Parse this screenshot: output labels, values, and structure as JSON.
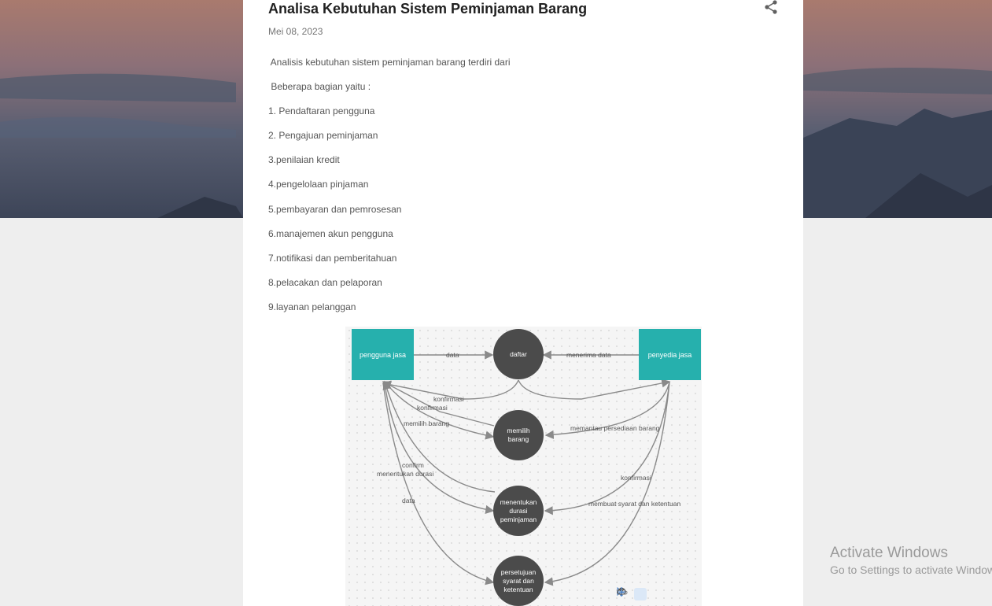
{
  "post": {
    "title": "Analisa Kebutuhan Sistem Peminjaman Barang",
    "date": "Mei 08, 2023",
    "share_icon": "share-icon",
    "lines": [
      " Analisis kebutuhan sistem peminjaman barang terdiri dari",
      " Beberapa bagian yaitu :",
      "1. Pendaftaran pengguna",
      "2. Pengajuan peminjaman",
      "3.penilaian kredit",
      "4.pengelolaan pinjaman",
      "5.pembayaran dan pemrosesan",
      "6.manajemen akun pengguna",
      "7.notifikasi dan pemberitahuan",
      "8.pelacakan dan pelaporan",
      "9.layanan pelanggan"
    ]
  },
  "diagram": {
    "entities": [
      "pengguna jasa",
      "penyedia jasa"
    ],
    "processes": [
      "daftar",
      "memilih\nbarang",
      "menentukan\ndurasi\npeminjaman",
      "persetujuan\nsyarat dan\nketentuan"
    ],
    "labels": {
      "data_top": "data",
      "menerima_data": "menerima data",
      "konfirmasi_1": "konfirmasi",
      "konfirmasi_2": "konfirmasi",
      "memilih_barang": "memilih barang",
      "memantau": "memantau persediaan barang",
      "confirm": "confirm",
      "menentukan_durasi": "menentukan durasi",
      "konfirmasi_3": "konfirmasi",
      "data_left": "data",
      "membuat_syarat": "membuat syarat dan ketentuan"
    },
    "toolbar": [
      "cloud-icon",
      "pointer-icon",
      "move-icon",
      "undo-icon",
      "redo-icon"
    ],
    "colors": {
      "entity": "#26b0ad",
      "process": "#4b4b4b",
      "arrow": "#8a8a8a"
    }
  },
  "watermark": {
    "title": "Activate Windows",
    "subtitle": "Go to Settings to activate Windows."
  }
}
